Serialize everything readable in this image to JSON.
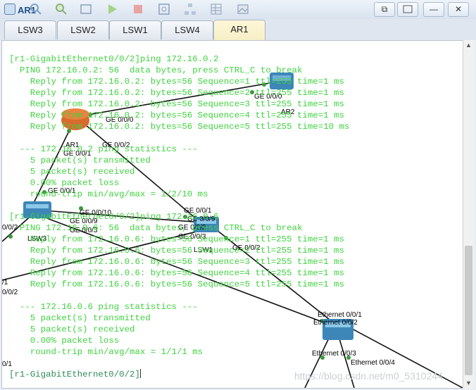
{
  "window": {
    "title": "AR1",
    "buttons": {
      "restore": "⧉",
      "minimize": "—",
      "close": "✕"
    }
  },
  "toolbar": [
    "search-icon",
    "zoom-icon",
    "console-icon",
    "start-icon",
    "stop-icon",
    "capture-icon",
    "topology-icon",
    "grid-icon",
    "image-icon"
  ],
  "tabs": [
    {
      "label": "LSW3",
      "active": false
    },
    {
      "label": "LSW2",
      "active": false
    },
    {
      "label": "LSW1",
      "active": false
    },
    {
      "label": "LSW4",
      "active": false
    },
    {
      "label": "AR1",
      "active": true
    }
  ],
  "console": {
    "lines": [
      "[r1-GigabitEthernet0/0/2]ping 172.16.0.2",
      "  PING 172.16.0.2: 56  data bytes, press CTRL_C to break",
      "    Reply from 172.16.0.2: bytes=56 Sequence=1 ttl=255 time=1 ms",
      "    Reply from 172.16.0.2: bytes=56 Sequence=2 ttl=255 time=1 ms",
      "    Reply from 172.16.0.2: bytes=56 Sequence=3 ttl=255 time=1 ms",
      "    Reply from 172.16.0.2: bytes=56 Sequence=4 ttl=255 time=1 ms",
      "    Reply from 172.16.0.2: bytes=56 Sequence=5 ttl=255 time=10 ms",
      "",
      "  --- 172.16.0.2 ping statistics ---",
      "    5 packet(s) transmitted",
      "    5 packet(s) received",
      "    0.00% packet loss",
      "    round-trip min/avg/max = 1/2/10 ms",
      "",
      "[r1-GigabitEthernet0/0/2]ping 172.16.0.6",
      "  PING 172.16.0.6: 56  data bytes, press CTRL_C to break",
      "    Reply from 172.16.0.6: bytes=56 Sequence=1 ttl=255 time=1 ms",
      "    Reply from 172.16.0.6: bytes=56 Sequence=2 ttl=255 time=1 ms",
      "    Reply from 172.16.0.6: bytes=56 Sequence=3 ttl=255 time=1 ms",
      "    Reply from 172.16.0.6: bytes=56 Sequence=4 ttl=255 time=1 ms",
      "    Reply from 172.16.0.6: bytes=56 Sequence=5 ttl=255 time=1 ms",
      "",
      "  --- 172.16.0.6 ping statistics ---",
      "    5 packet(s) transmitted",
      "    5 packet(s) received",
      "    0.00% packet loss",
      "    round-trip min/avg/max = 1/1/1 ms",
      "",
      "[r1-GigabitEthernet0/0/2]"
    ]
  },
  "topology": {
    "devices": {
      "ar1": "AR1",
      "ar2": "AR2",
      "lsw1": "LSW1",
      "lsw3": "LSW3"
    },
    "ports": {
      "p1": "GE 0/0/0",
      "p2": "GE 0/0/2",
      "p3": "GE 0/0/0",
      "p4": "GE 0/0/1",
      "p5": "GE 0/0/1",
      "p6": "GE 0/0/10",
      "p7": "GE 0/0/1",
      "p8": "GE 0/0/9",
      "p9": "GE 0/0/3",
      "p10": "GE 0/0/9",
      "p11": "GE 0/0/2",
      "p12": "0/0/2",
      "p13": "GE 0/0/3",
      "p14": "GE 0/0/2",
      "p15": "Ethernet 0/0/1",
      "p16": "Ethernet 0/0/2",
      "p17": "Ethernet 0/0/3",
      "p18": "Ethernet 0/0/4",
      "p19": "/1",
      "p20": "0/0/2",
      "p21": "0/1"
    }
  },
  "watermark": "https://blog.csdn.net/m0_5310244",
  "colors": {
    "console_text": "#3fd33f",
    "active_tab": "#f6efc6",
    "link": "#000000"
  }
}
